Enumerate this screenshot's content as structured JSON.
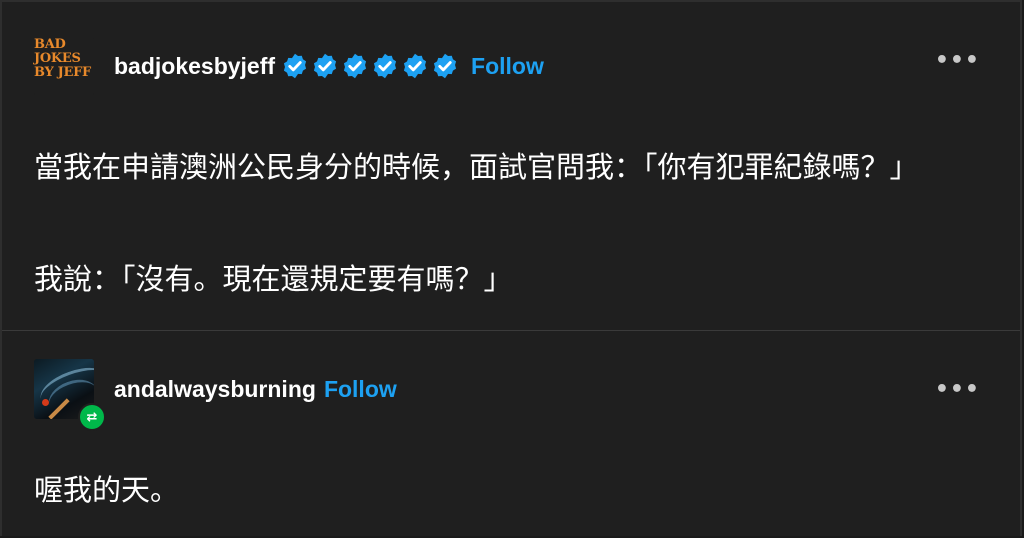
{
  "posts": [
    {
      "username": "badjokesbyjeff",
      "follow_label": "Follow",
      "avatar": {
        "type": "logo",
        "lines": [
          "BAD",
          "JOKES",
          "BY JEFF"
        ],
        "color": "#e8892b"
      },
      "verified_badge_count": 6,
      "badge_color": "#1da1f2",
      "more_icon": "ellipsis-icon",
      "paragraphs": [
        "當我在申請澳洲公民身分的時候，面試官問我：「你有犯罪紀錄嗎？」",
        "我說：「沒有。現在還規定要有嗎？」"
      ]
    },
    {
      "username": "andalwaysburning",
      "follow_label": "Follow",
      "avatar": {
        "type": "photo",
        "description_icon": "burning-match-icon",
        "reblog_icon": "reblog-icon",
        "reblog_color": "#00b84a"
      },
      "more_icon": "ellipsis-icon",
      "paragraphs": [
        "喔我的天。"
      ]
    }
  ],
  "colors": {
    "background": "#1f1f1f",
    "text": "#ffffff",
    "follow": "#1da1f2",
    "divider": "#3a3a3a"
  }
}
